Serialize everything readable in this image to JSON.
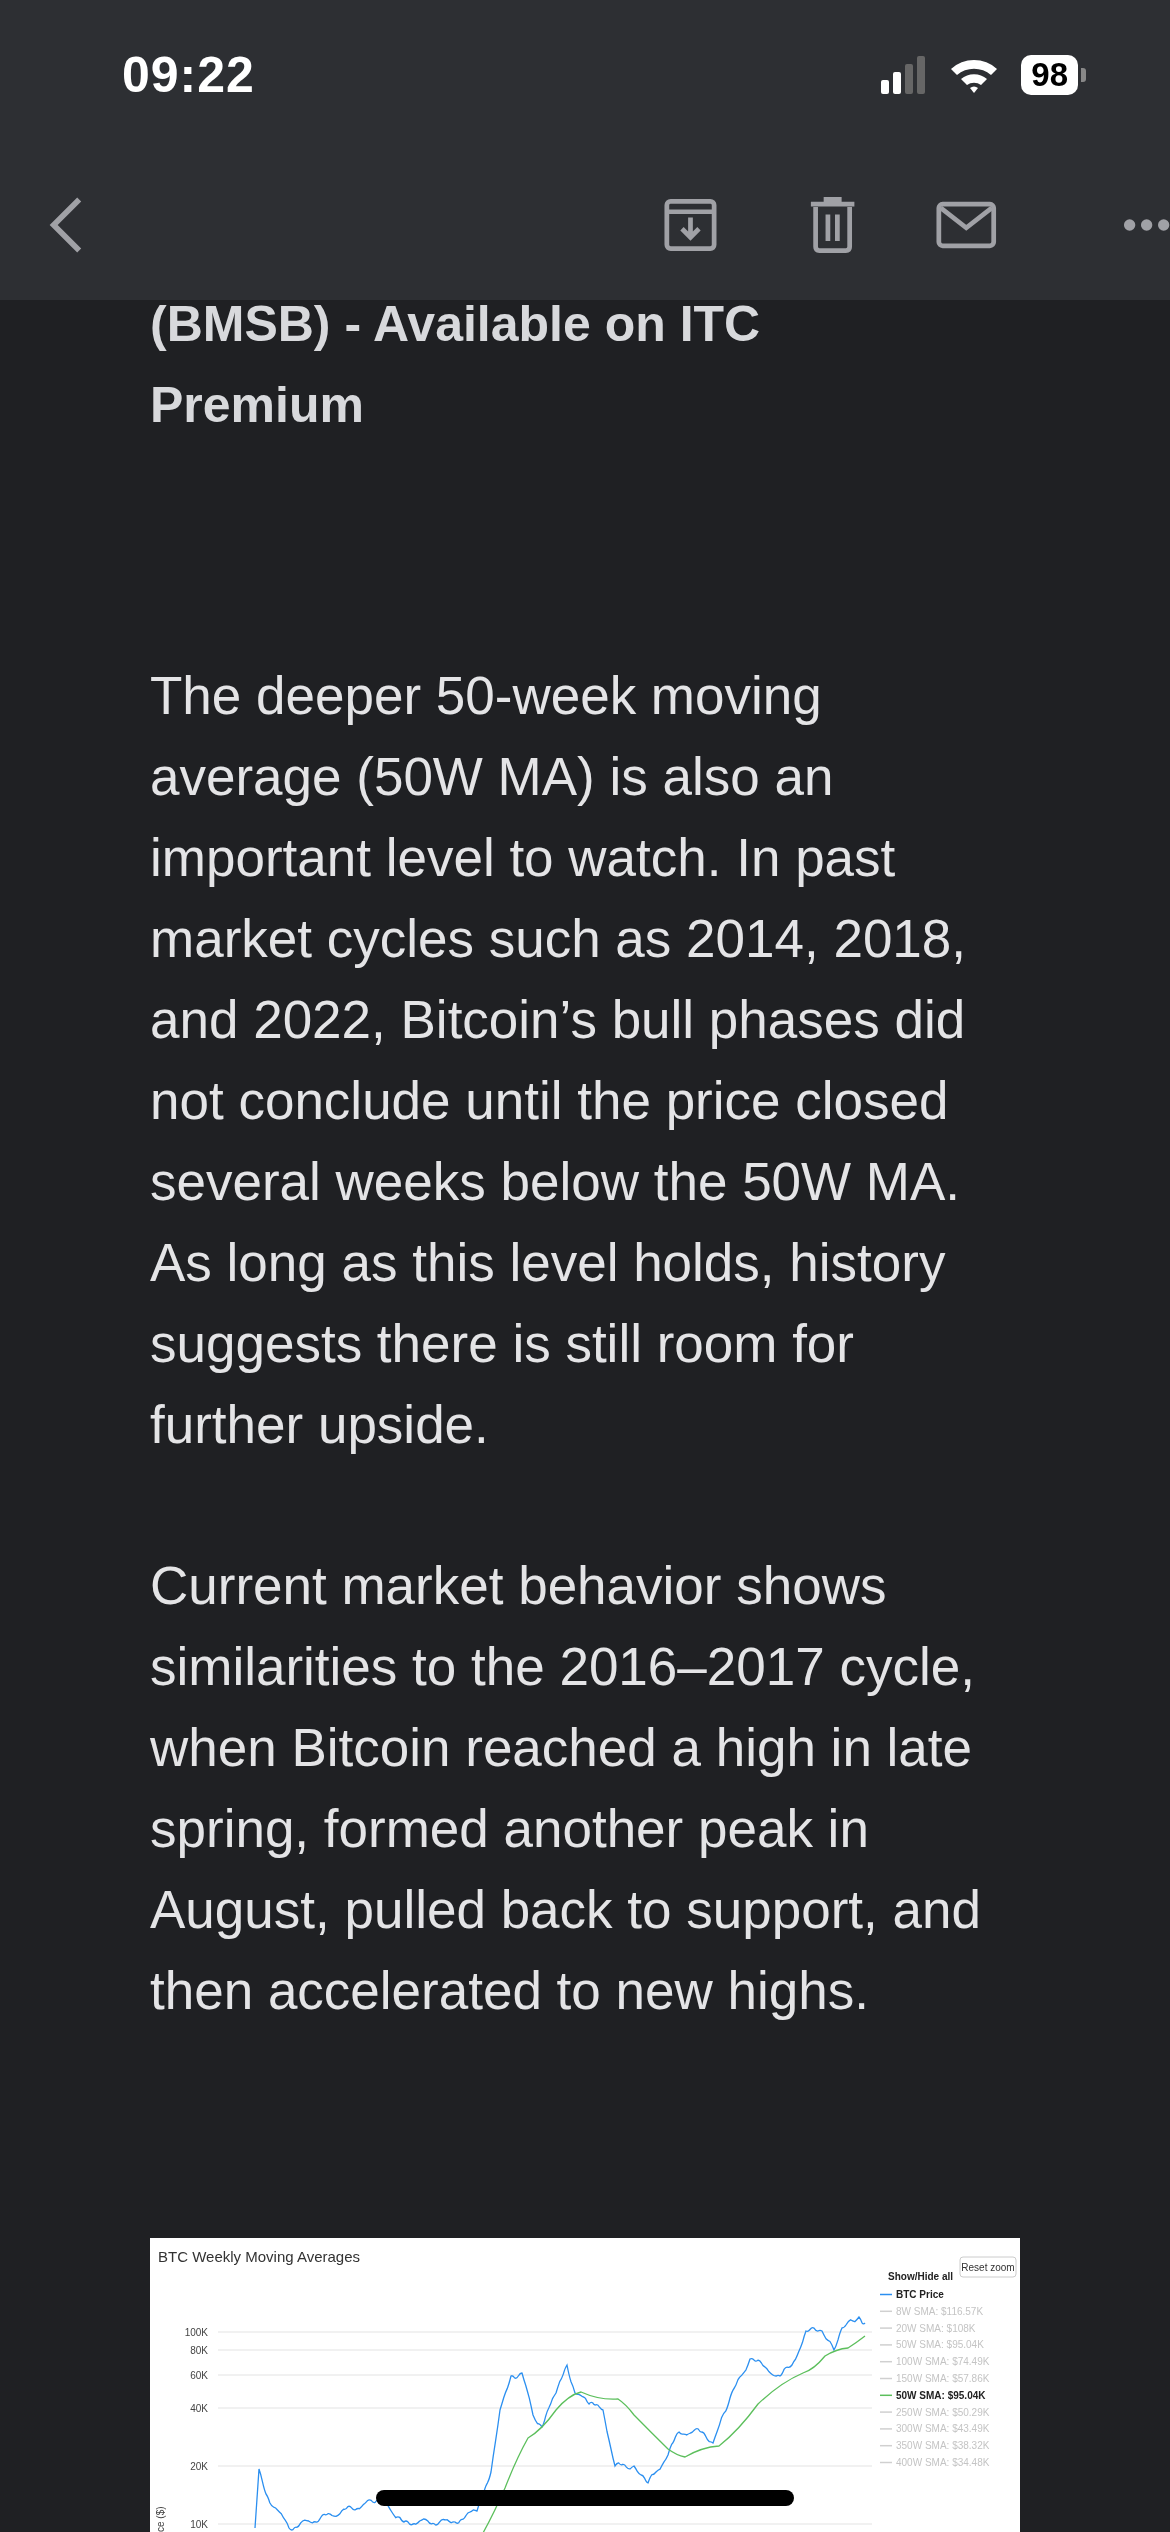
{
  "status_bar": {
    "time": "09:22",
    "battery": "98"
  },
  "article": {
    "title": "(BMSB) - Available on ITC Premium",
    "paragraphs": [
      "The deeper 50-week moving average (50W MA) is also an important level to watch. In past market cycles such as 2014, 2018, and 2022, Bitcoin’s bull phases did not conclude until the price closed several weeks below the 50W MA. As long as this level holds, history suggests there is still room for further upside.",
      "Current market behavior shows similarities to the 2016–2017 cycle, when Bitcoin reached a high in late spring, formed another peak in August, pulled back to support, and then accelerated to new highs."
    ],
    "chart": {
      "title": "BTC Weekly Moving Averages",
      "reset_button": "Reset zoom",
      "legend_header": "Show/Hide all",
      "y_axis_label": "ce ($)",
      "y_ticks": [
        "100K",
        "80K",
        "60K",
        "40K",
        "20K",
        "10K"
      ],
      "legend": [
        {
          "label": "BTC Price",
          "active": true,
          "color": "#2b8ff0"
        },
        {
          "label": "8W SMA: $116.57K",
          "active": false
        },
        {
          "label": "20W SMA: $108K",
          "active": false
        },
        {
          "label": "50W SMA: $95.04K",
          "active": false
        },
        {
          "label": "100W SMA: $74.49K",
          "active": false
        },
        {
          "label": "150W SMA: $57.86K",
          "active": false
        },
        {
          "label": "50W SMA: $95.04K",
          "active": true,
          "color": "#5cbf5c"
        },
        {
          "label": "250W SMA: $50.29K",
          "active": false
        },
        {
          "label": "300W SMA: $43.49K",
          "active": false
        },
        {
          "label": "350W SMA: $38.32K",
          "active": false
        },
        {
          "label": "400W SMA: $34.48K",
          "active": false
        }
      ]
    }
  }
}
